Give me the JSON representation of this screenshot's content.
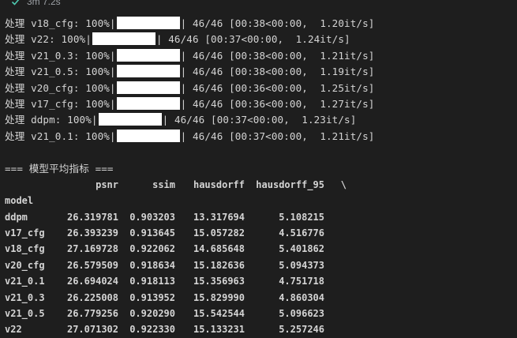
{
  "status": {
    "elapsed": "3m 7.2s"
  },
  "progress_lines": [
    {
      "prefix": "处理 v18_cfg: 100%|",
      "suffix": "| 46/46 [00:38<00:00,  1.20it/s]"
    },
    {
      "prefix": "处理 v22: 100%|",
      "suffix": "| 46/46 [00:37<00:00,  1.24it/s]"
    },
    {
      "prefix": "处理 v21_0.3: 100%|",
      "suffix": "| 46/46 [00:38<00:00,  1.21it/s]"
    },
    {
      "prefix": "处理 v21_0.5: 100%|",
      "suffix": "| 46/46 [00:38<00:00,  1.19it/s]"
    },
    {
      "prefix": "处理 v20_cfg: 100%|",
      "suffix": "| 46/46 [00:36<00:00,  1.25it/s]"
    },
    {
      "prefix": "处理 v17_cfg: 100%|",
      "suffix": "| 46/46 [00:36<00:00,  1.27it/s]"
    },
    {
      "prefix": "处理 ddpm: 100%|",
      "suffix": "| 46/46 [00:37<00:00,  1.23it/s]"
    },
    {
      "prefix": "处理 v21_0.1: 100%|",
      "suffix": "| 46/46 [00:37<00:00,  1.21it/s]"
    }
  ],
  "metrics": {
    "heading": "=== 模型平均指标 ===",
    "columns": [
      "psnr",
      "ssim",
      "hausdorff",
      "hausdorff_95",
      "\\"
    ],
    "index_name": "model",
    "rows": [
      [
        "ddpm",
        "26.319781",
        "0.903203",
        "13.317694",
        "5.108215"
      ],
      [
        "v17_cfg",
        "26.393239",
        "0.913645",
        "15.057282",
        "4.516776"
      ],
      [
        "v18_cfg",
        "27.169728",
        "0.922062",
        "14.685648",
        "5.401862"
      ],
      [
        "v20_cfg",
        "26.579509",
        "0.918634",
        "15.182636",
        "5.094373"
      ],
      [
        "v21_0.1",
        "26.694024",
        "0.918113",
        "15.356963",
        "4.751718"
      ],
      [
        "v21_0.3",
        "26.225008",
        "0.913952",
        "15.829990",
        "4.860304"
      ],
      [
        "v21_0.5",
        "26.779256",
        "0.920290",
        "15.542544",
        "5.096623"
      ],
      [
        "v22",
        "27.071302",
        "0.922330",
        "15.133231",
        "5.257246"
      ]
    ]
  }
}
